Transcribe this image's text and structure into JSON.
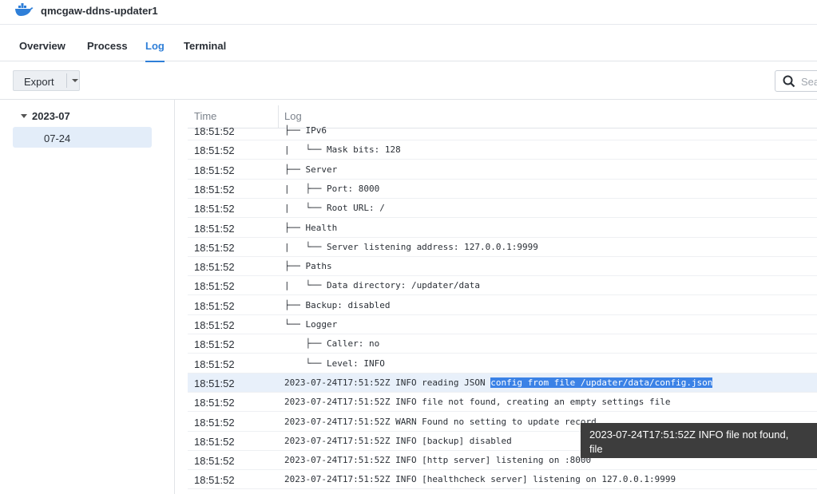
{
  "app": {
    "title": "qmcgaw-ddns-updater1",
    "icon": "docker-whale-icon",
    "accent": "#2f7fd8"
  },
  "tabs": [
    {
      "label": "Overview",
      "active": false
    },
    {
      "label": "Process",
      "active": false
    },
    {
      "label": "Log",
      "active": true
    },
    {
      "label": "Terminal",
      "active": false
    }
  ],
  "toolbar": {
    "export_label": "Export",
    "search_placeholder": "Sea"
  },
  "sidebar": {
    "group_label": "2023-07",
    "item_label": "07-24"
  },
  "table": {
    "headers": {
      "time": "Time",
      "log": "Log"
    },
    "rows": [
      {
        "time": "18:51:52",
        "log": "├── IPv6"
      },
      {
        "time": "18:51:52",
        "log": "|   └── Mask bits: 128"
      },
      {
        "time": "18:51:52",
        "log": "├── Server"
      },
      {
        "time": "18:51:52",
        "log": "|   ├── Port: 8000"
      },
      {
        "time": "18:51:52",
        "log": "|   └── Root URL: /"
      },
      {
        "time": "18:51:52",
        "log": "├── Health"
      },
      {
        "time": "18:51:52",
        "log": "|   └── Server listening address: 127.0.0.1:9999"
      },
      {
        "time": "18:51:52",
        "log": "├── Paths"
      },
      {
        "time": "18:51:52",
        "log": "|   └── Data directory: /updater/data"
      },
      {
        "time": "18:51:52",
        "log": "├── Backup: disabled"
      },
      {
        "time": "18:51:52",
        "log": "└── Logger"
      },
      {
        "time": "18:51:52",
        "log": "    ├── Caller: no"
      },
      {
        "time": "18:51:52",
        "log": "    └── Level: INFO"
      },
      {
        "time": "18:51:52",
        "log": "2023-07-24T17:51:52Z INFO reading JSON ",
        "highlight": "config from file /updater/data/config.json"
      },
      {
        "time": "18:51:52",
        "log": "2023-07-24T17:51:52Z INFO file not found, creating an empty settings file"
      },
      {
        "time": "18:51:52",
        "log": "2023-07-24T17:51:52Z WARN Found no setting to update record"
      },
      {
        "time": "18:51:52",
        "log": "2023-07-24T17:51:52Z INFO [backup] disabled"
      },
      {
        "time": "18:51:52",
        "log": "2023-07-24T17:51:52Z INFO [http server] listening on :8000"
      },
      {
        "time": "18:51:52",
        "log": "2023-07-24T17:51:52Z INFO [healthcheck server] listening on 127.0.0.1:9999"
      }
    ]
  },
  "tooltip": {
    "line1": "2023-07-24T17:51:52Z INFO file not found,",
    "line2": "file"
  }
}
